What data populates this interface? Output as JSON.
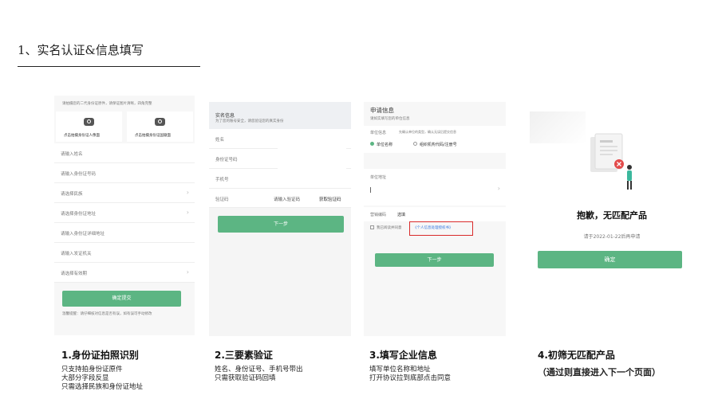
{
  "section_title": "1、实名认证&信息填写",
  "screen1": {
    "top_note": "请拍摄您的二代身份证原件，请保证图片清晰，四角完整",
    "front_label": "点击拍摄身份证人像面",
    "back_label": "点击拍摄身份证国徽面",
    "fields": [
      "请输入姓名",
      "请输入身份证号码",
      "请选择民族",
      "请选择身份证地址",
      "请输入身份证详细地址",
      "请输入发证机关",
      "请选择有效期"
    ],
    "submit_label": "确定提交",
    "bottom_note": "温馨提醒：请仔细核对信息是否有误，如有误可手动修改"
  },
  "screen2": {
    "heading": "实名信息",
    "subheading": "为了您的账号安全，请您验证您的真实身份",
    "fields": [
      "姓名",
      "身份证号码",
      "手机号"
    ],
    "code_label": "验证码",
    "code_placeholder": "请输入验证码",
    "get_code_label": "获取验证码",
    "next_label": "下一步"
  },
  "screen3": {
    "heading": "申请信息",
    "subheading": "请如实填写您的单位信息",
    "unit_label": "单位信息",
    "unit_note": "先确认单位的类型，确认无误后提交信息",
    "option1": "单位名称",
    "option2": "组织机构代码/注册号",
    "address_label": "单位地址",
    "sales_label": "营销编码",
    "sales_value": "选填",
    "agree_text": "我已阅读并同意",
    "agree_link": "《个人信息处理授权书》",
    "next_label": "下一步"
  },
  "screen4": {
    "title": "抱歉，无匹配产品",
    "subtitle": "请于2022-01-22后再申请",
    "confirm_label": "确定"
  },
  "captions": [
    {
      "title": "1.身份证拍照识别",
      "lines": [
        "只支持拍身份证原件",
        "大部分字段反显",
        "只需选择民族和身份证地址"
      ]
    },
    {
      "title": "2.三要素验证",
      "lines": [
        "姓名、身份证号、手机号带出",
        "只需获取验证码回填"
      ]
    },
    {
      "title": "3.填写企业信息",
      "lines": [
        "填写单位名称和地址",
        "打开协议拉到底部点击同意"
      ]
    },
    {
      "title": "4.初筛无匹配产品",
      "lines": [
        "（通过则直接进入下一个页面）"
      ]
    }
  ],
  "colors": {
    "accent": "#5cb583",
    "warning": "#e03232",
    "link": "#3a7be0"
  }
}
